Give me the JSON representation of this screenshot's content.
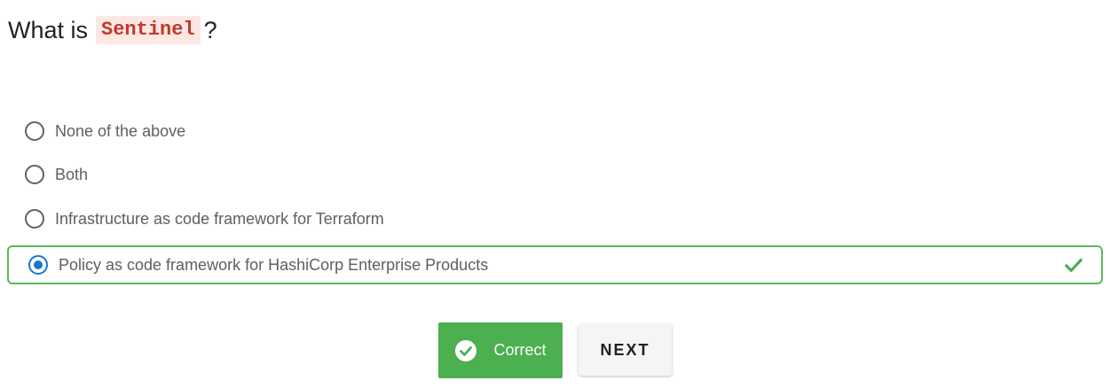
{
  "question": {
    "prefix": "What is",
    "code": "Sentinel",
    "suffix": "?"
  },
  "options": [
    {
      "label": "None of the above",
      "selected": false
    },
    {
      "label": "Both",
      "selected": false
    },
    {
      "label": "Infrastructure as code framework for Terraform",
      "selected": false
    },
    {
      "label": "Policy as code framework for HashiCorp Enterprise Products",
      "selected": true,
      "result": "correct"
    }
  ],
  "buttons": {
    "correct_label": "Correct",
    "next_label": "NEXT"
  },
  "colors": {
    "accent_green": "#4caf50",
    "radio_selected": "#1976d2",
    "code_text": "#c0392b",
    "code_bg": "#fbe7e4"
  },
  "icons": {
    "correct_icon": "check-circle-icon",
    "selected_check": "checkmark-icon"
  }
}
